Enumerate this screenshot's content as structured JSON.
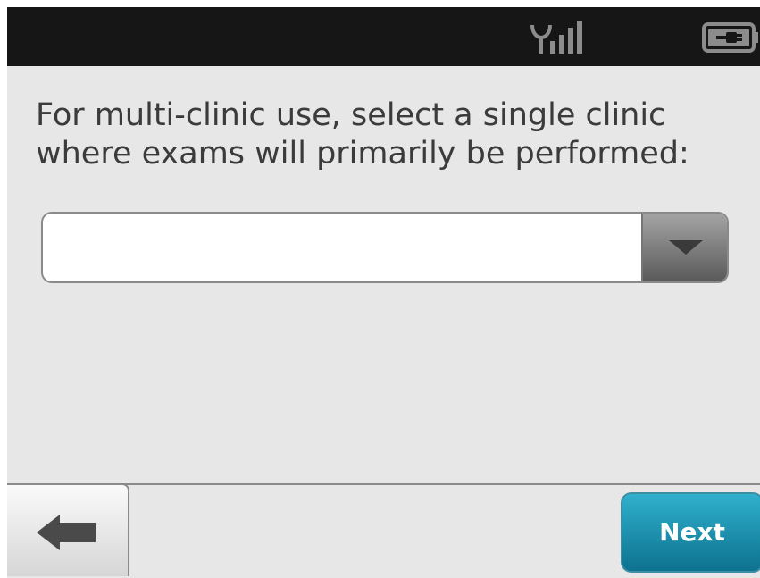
{
  "status_bar": {
    "signal_icon": "signal-antenna-icon",
    "battery_icon": "battery-plugged-icon"
  },
  "prompt": {
    "text": "For multi-clinic use, select a single clinic where exams will primarily be performed:"
  },
  "clinic_dropdown": {
    "selected_value": "",
    "toggle_icon": "chevron-down-icon"
  },
  "footer": {
    "back_icon": "arrow-left-icon",
    "next_label": "Next"
  },
  "colors": {
    "status_bar_bg": "#161616",
    "screen_bg": "#e7e7e7",
    "next_button_top": "#2fb0cc",
    "next_button_bottom": "#0d7290",
    "prompt_text": "#3b3b3b"
  }
}
